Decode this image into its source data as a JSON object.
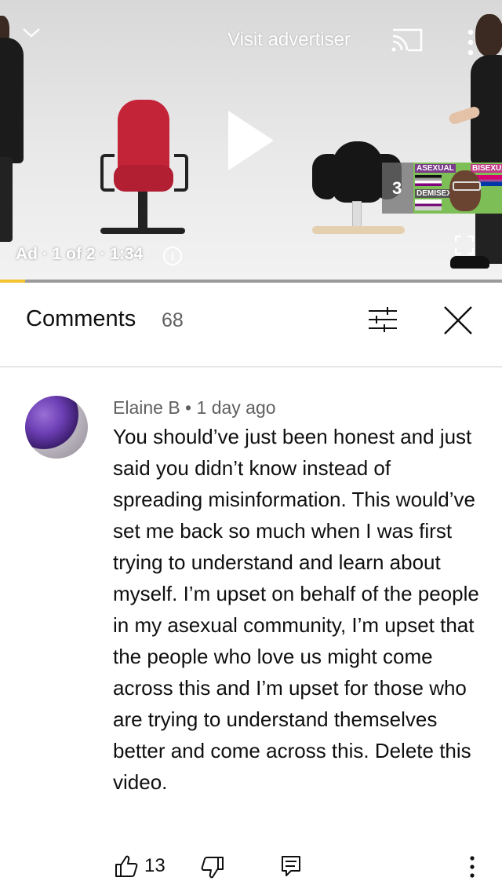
{
  "player": {
    "visit_advertiser": "Visit advertiser",
    "ad_label": "Ad · 1 of 2 · 1:34",
    "info": "i",
    "up_next_count": "3",
    "thumbnail_tags": [
      "ASEXUAL",
      "BISEXUAL",
      "DEMISEXUAL"
    ],
    "ad_progress_percent": 5,
    "icons": [
      "chevron-down-icon",
      "cast-icon",
      "more-vert-icon",
      "play-icon",
      "fullscreen-icon",
      "info-icon"
    ]
  },
  "comments_header": {
    "title": "Comments",
    "count": "68",
    "icons": [
      "sort-icon",
      "close-icon"
    ]
  },
  "comment": {
    "author": "Elaine B",
    "separator": " • ",
    "time": "1 day ago",
    "text": "You should’ve just been honest and just said you didn’t know instead of spreading misinformation. This would’ve set me back so much when I was first trying to understand and learn about myself. I’m upset on behalf of the people in my asexual community, I’m upset that the people who love us might come across this and I’m upset for those who are trying to understand themselves better and come across this. Delete this video.",
    "likes": "13",
    "icons": [
      "like-icon",
      "dislike-icon",
      "reply-icon",
      "more-vert-icon"
    ]
  },
  "colors": {
    "ad_progress": "#f4c430",
    "text_primary": "#0f0f0f",
    "text_secondary": "#606060",
    "chair_red": "#c42438"
  }
}
